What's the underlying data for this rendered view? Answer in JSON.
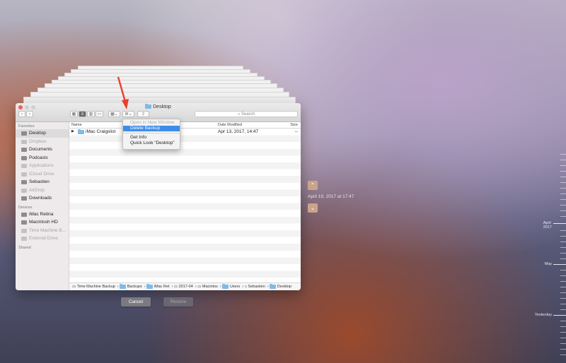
{
  "window": {
    "title": "Desktop"
  },
  "toolbar": {
    "search_placeholder": "Search",
    "back": "‹",
    "forward": "›"
  },
  "sidebar": {
    "favorites_header": "Favorites",
    "favorites": [
      {
        "label": "Desktop",
        "dim": false,
        "selected": true
      },
      {
        "label": "Dropbox",
        "dim": true
      },
      {
        "label": "Documents",
        "dim": false
      },
      {
        "label": "Podcasts",
        "dim": false
      },
      {
        "label": "Applications",
        "dim": true
      },
      {
        "label": "iCloud Drive",
        "dim": true
      },
      {
        "label": "Sebastien",
        "dim": false
      },
      {
        "label": "AirDrop",
        "dim": true
      },
      {
        "label": "Downloads",
        "dim": false
      }
    ],
    "devices_header": "Devices",
    "devices": [
      {
        "label": "iMac Retina",
        "dim": false
      },
      {
        "label": "Macintosh HD",
        "dim": false
      },
      {
        "label": "Time Machine B...",
        "dim": true
      },
      {
        "label": "External Drive",
        "dim": true
      }
    ],
    "shared_header": "Shared"
  },
  "columns": {
    "name": "Name",
    "date": "Date Modified",
    "size": "Size"
  },
  "files": [
    {
      "name": "iMac Craigslist",
      "date": "Apr 13, 2017, 14:47",
      "size": "--"
    }
  ],
  "context_menu": {
    "items": [
      {
        "label": "Open in New Window",
        "disabled": true
      },
      {
        "label": "Delete Backup",
        "highlighted": true
      },
      {
        "label": "Get Info"
      },
      {
        "label": "Quick Look “Desktop”"
      }
    ]
  },
  "path": [
    "Time Machine Backup",
    "Backups",
    "iMac Ret",
    "2017-04",
    "Macintos",
    "Users",
    "Sebastien",
    "Desktop"
  ],
  "buttons": {
    "cancel": "Cancel",
    "restore": "Restore"
  },
  "timemachine": {
    "snapshot": "April 19, 2017 at 17:47",
    "up": "⌃",
    "down": "⌄",
    "timeline_labels": {
      "april": "April 2017",
      "may": "May",
      "yesterday": "Yesterday"
    }
  },
  "colors": {
    "accent": "#3f8ce8",
    "annotation_arrow": "#e8402a",
    "tm_button": "#c9a48c"
  }
}
